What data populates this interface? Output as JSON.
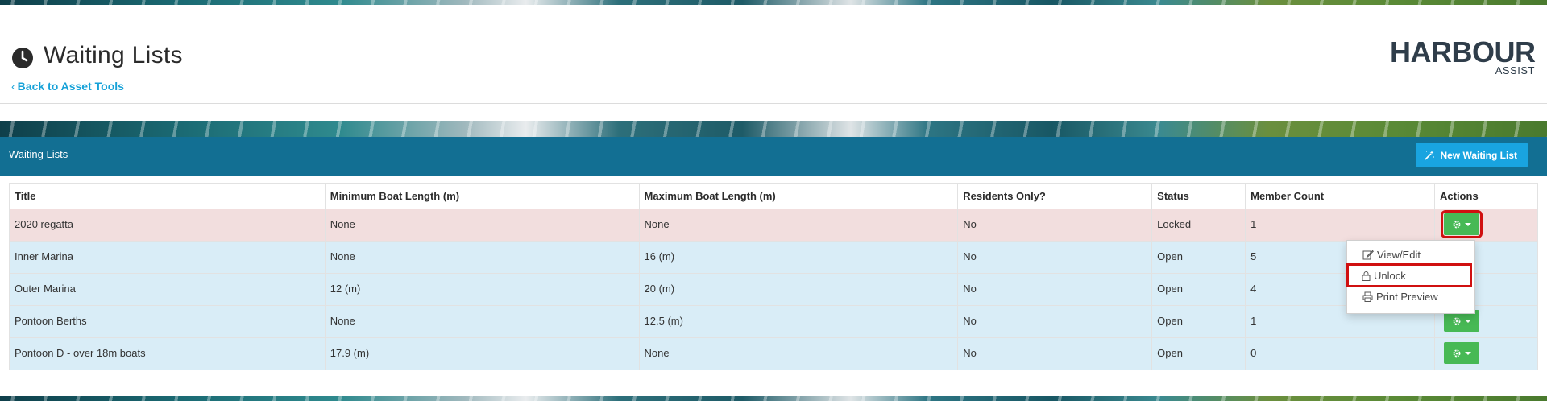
{
  "page": {
    "title": "Waiting Lists",
    "back_link": "Back to Asset Tools"
  },
  "logo": {
    "name": "HARBOUR",
    "sub": "ASSIST"
  },
  "panel": {
    "title": "Waiting Lists",
    "new_button": "New Waiting List"
  },
  "table": {
    "columns": [
      "Title",
      "Minimum Boat Length (m)",
      "Maximum Boat Length (m)",
      "Residents Only?",
      "Status",
      "Member Count",
      "Actions"
    ],
    "rows": [
      {
        "title": "2020 regatta",
        "min": "None",
        "max": "None",
        "residents": "No",
        "status": "Locked",
        "members": "1"
      },
      {
        "title": "Inner Marina",
        "min": "None",
        "max": "16 (m)",
        "residents": "No",
        "status": "Open",
        "members": "5"
      },
      {
        "title": "Outer Marina",
        "min": "12 (m)",
        "max": "20 (m)",
        "residents": "No",
        "status": "Open",
        "members": "4"
      },
      {
        "title": "Pontoon Berths",
        "min": "None",
        "max": "12.5 (m)",
        "residents": "No",
        "status": "Open",
        "members": "1"
      },
      {
        "title": "Pontoon D - over 18m boats",
        "min": "17.9 (m)",
        "max": "None",
        "residents": "No",
        "status": "Open",
        "members": "0"
      }
    ]
  },
  "dropdown": {
    "items": [
      "View/Edit",
      "Unlock",
      "Print Preview"
    ]
  },
  "colors": {
    "panel_header": "#126f93",
    "new_button": "#19a4e0",
    "action_button": "#47b955",
    "row_locked": "#f2dede",
    "row_open": "#d9edf7",
    "highlight": "#d01010",
    "link": "#17a2d8"
  },
  "icons": [
    "clock-icon",
    "chevron-left-icon",
    "magic-wand-icon",
    "gear-icon",
    "caret-down-icon",
    "edit-icon",
    "lock-icon",
    "print-icon"
  ]
}
